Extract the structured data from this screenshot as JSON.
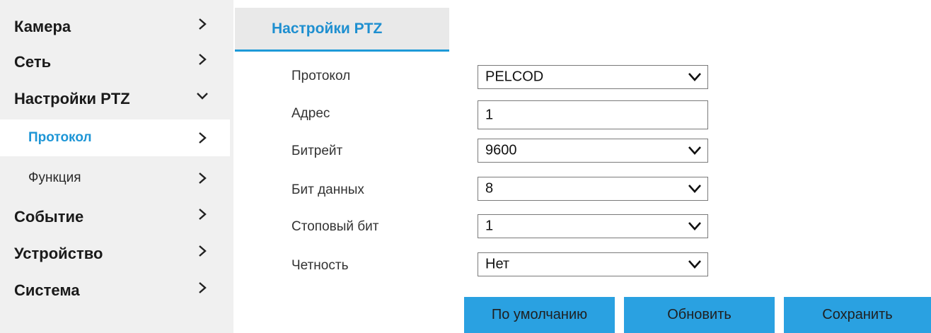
{
  "sidebar": {
    "items": [
      {
        "label": "Камера",
        "icon": "chevron-right-icon"
      },
      {
        "label": "Сеть",
        "icon": "chevron-right-icon"
      },
      {
        "label": "Настройки PTZ",
        "icon": "chevron-down-icon"
      },
      {
        "label": "Протокол",
        "icon": "chevron-right-icon",
        "active": true
      },
      {
        "label": "Функция",
        "icon": "chevron-right-icon"
      },
      {
        "label": "Событие",
        "icon": "chevron-right-icon"
      },
      {
        "label": "Устройство",
        "icon": "chevron-right-icon"
      },
      {
        "label": "Система",
        "icon": "chevron-right-icon"
      }
    ]
  },
  "tab": {
    "label": "Настройки PTZ"
  },
  "form": {
    "rows": [
      {
        "label": "Протокол",
        "value": "PELCOD",
        "type": "select"
      },
      {
        "label": "Адрес",
        "value": "1",
        "type": "input"
      },
      {
        "label": "Битрейт",
        "value": "9600",
        "type": "select"
      },
      {
        "label": "Бит данных",
        "value": "8",
        "type": "select"
      },
      {
        "label": "Стоповый бит",
        "value": "1",
        "type": "select"
      },
      {
        "label": "Четность",
        "value": "Нет",
        "type": "select"
      }
    ]
  },
  "buttons": {
    "default_label": "По умолчанию",
    "refresh_label": "Обновить",
    "save_label": "Сохранить"
  },
  "colors": {
    "accent": "#1e96d6",
    "button": "#2aa1e1",
    "sidebar_bg": "#f0f0f0",
    "tab_bg": "#e9e9e9"
  }
}
